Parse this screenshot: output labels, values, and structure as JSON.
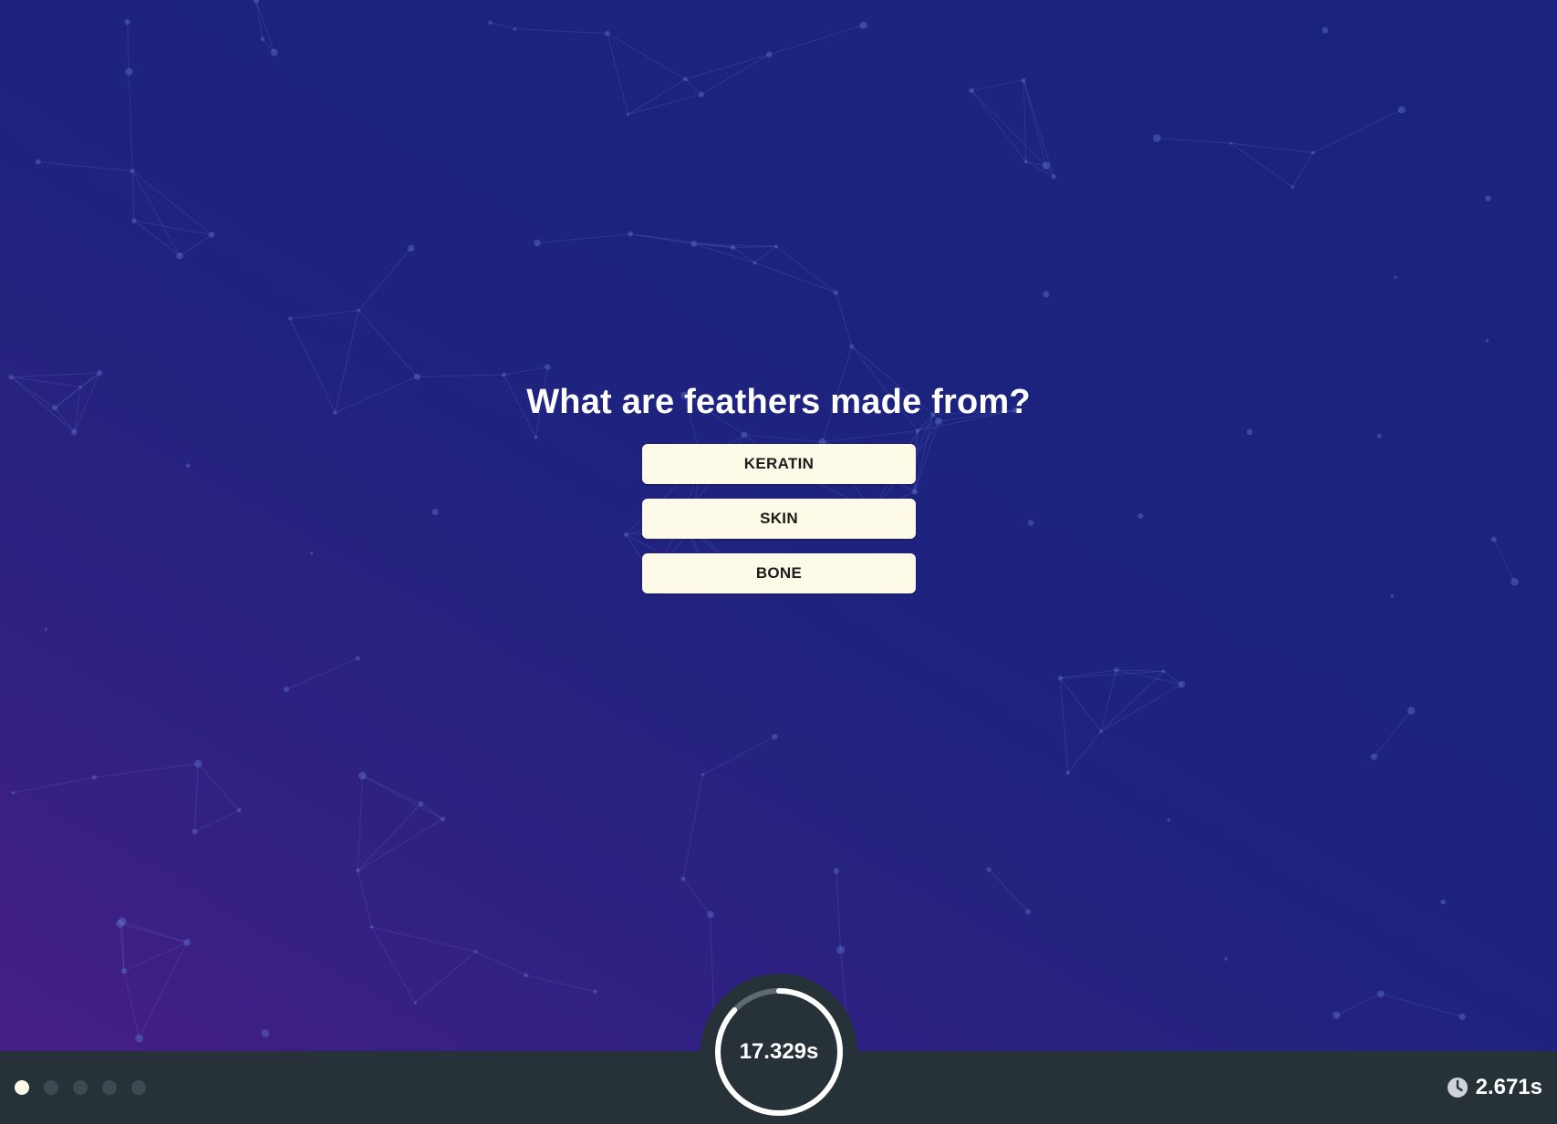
{
  "quiz": {
    "question": "What are feathers made from?",
    "answers": [
      "KERATIN",
      "SKIN",
      "BONE"
    ]
  },
  "progress": {
    "total_questions": 5,
    "current_index": 1
  },
  "timer": {
    "remaining_label": "17.329s",
    "remaining_fraction": 0.87
  },
  "elapsed": {
    "icon": "clock-icon",
    "label": "2.671s"
  },
  "colors": {
    "answer_bg": "#fdfbe8",
    "footer_bg": "#263238",
    "timer_ring": "#ffffff",
    "timer_track": "#5f6b71",
    "dot_active": "#fdfbe8",
    "dot_inactive": "#3e4a51"
  }
}
